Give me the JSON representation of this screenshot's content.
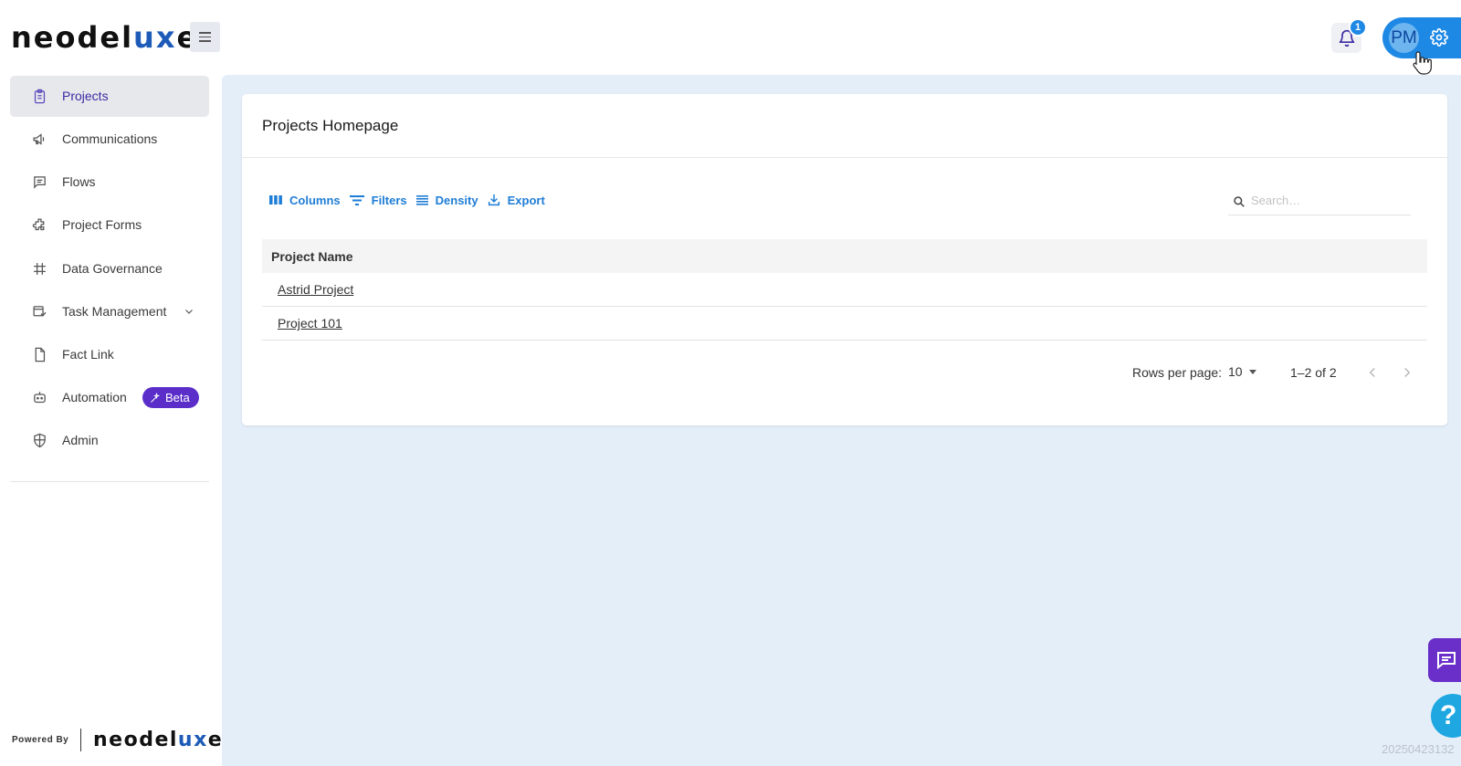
{
  "header": {
    "logo_part1": "neodel",
    "logo_part2": "ux",
    "logo_part3": "e",
    "logo_tm": "™",
    "notification_count": "1",
    "avatar_initials": "PM"
  },
  "sidebar": {
    "items": [
      {
        "label": "Projects",
        "icon": "clipboard-icon"
      },
      {
        "label": "Communications",
        "icon": "megaphone-icon"
      },
      {
        "label": "Flows",
        "icon": "message-square-icon"
      },
      {
        "label": "Project Forms",
        "icon": "puzzle-icon"
      },
      {
        "label": "Data Governance",
        "icon": "grid-icon"
      },
      {
        "label": "Task Management",
        "icon": "task-icon"
      },
      {
        "label": "Fact Link",
        "icon": "file-icon"
      },
      {
        "label": "Automation",
        "icon": "robot-icon"
      },
      {
        "label": "Admin",
        "icon": "shield-icon"
      }
    ],
    "beta_label": "Beta",
    "powered_by": "Powered By",
    "powered_logo_part1": "neodel",
    "powered_logo_part2": "ux",
    "powered_logo_part3": "e",
    "powered_logo_tm": "™"
  },
  "main": {
    "title": "Projects Homepage",
    "toolbar": {
      "columns": "Columns",
      "filters": "Filters",
      "density": "Density",
      "export": "Export"
    },
    "search_placeholder": "Search…",
    "table": {
      "header": "Project Name",
      "rows": [
        "Astrid Project",
        "Project 101"
      ]
    },
    "pagination": {
      "rows_per_page_label": "Rows per page:",
      "rows_per_page_value": "10",
      "range": "1–2 of 2"
    }
  },
  "build_number": "20250423132",
  "colors": {
    "accent": "#1e88e5",
    "brand_purple": "#5b2ec9",
    "main_bg": "#e4eef9"
  }
}
